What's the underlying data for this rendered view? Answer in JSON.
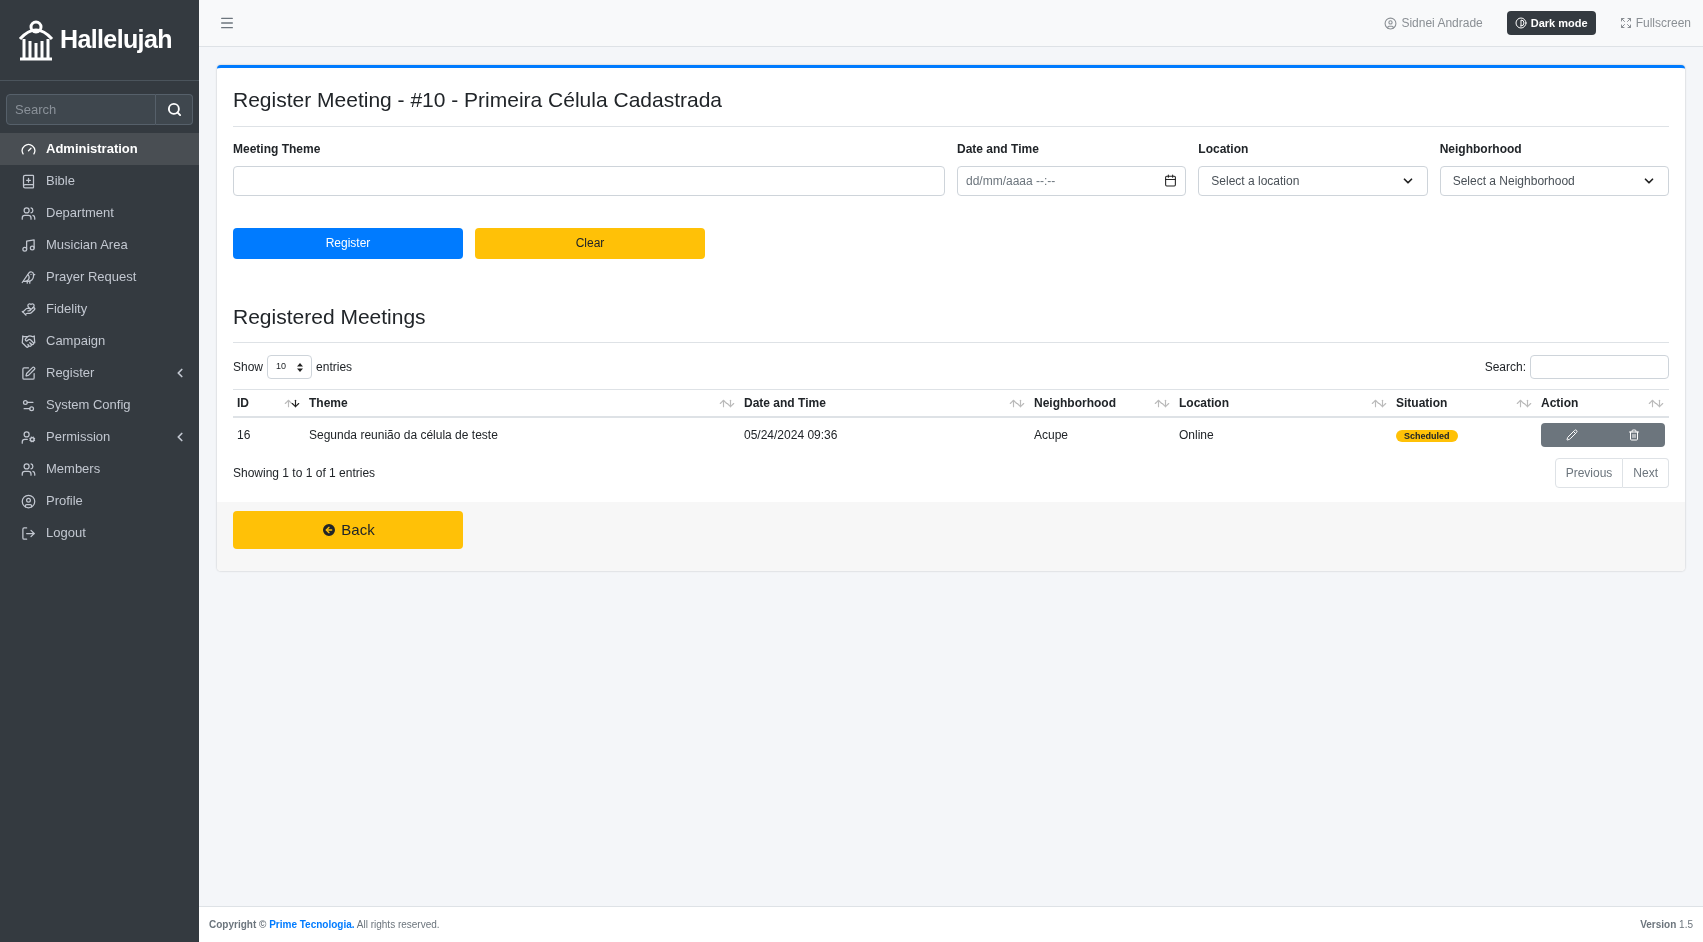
{
  "sidebar": {
    "logo": "Hallelujah",
    "search": {
      "placeholder": "Search"
    },
    "items": [
      {
        "label": "Administration",
        "selected": true,
        "expandable": false
      },
      {
        "label": "Bible",
        "selected": false,
        "expandable": false
      },
      {
        "label": "Department",
        "selected": false,
        "expandable": false
      },
      {
        "label": "Musician Area",
        "selected": false,
        "expandable": false
      },
      {
        "label": "Prayer Request",
        "selected": false,
        "expandable": false
      },
      {
        "label": "Fidelity",
        "selected": false,
        "expandable": false
      },
      {
        "label": "Campaign",
        "selected": false,
        "expandable": false
      },
      {
        "label": "Register",
        "selected": false,
        "expandable": true
      },
      {
        "label": "System Config",
        "selected": false,
        "expandable": false
      },
      {
        "label": "Permission",
        "selected": false,
        "expandable": true
      },
      {
        "label": "Members",
        "selected": false,
        "expandable": false
      },
      {
        "label": "Profile",
        "selected": false,
        "expandable": false
      },
      {
        "label": "Logout",
        "selected": false,
        "expandable": false
      }
    ]
  },
  "topbar": {
    "user": "Sidnei Andrade",
    "dark_mode": "Dark mode",
    "fullscreen": "Fullscreen"
  },
  "form": {
    "title": "Register Meeting - #10 - Primeira Célula Cadastrada",
    "fields": [
      {
        "kind": "text",
        "label": "Meeting Theme"
      },
      {
        "kind": "datetime",
        "label": "Date and Time",
        "placeholder": "dd/mm/aaaa --:--"
      },
      {
        "kind": "select",
        "label": "Location",
        "value": "Select a location"
      },
      {
        "kind": "select",
        "label": "Neighborhood",
        "value": "Select a Neighborhood"
      }
    ],
    "buttons": [
      {
        "kind": "primary",
        "label": "Register"
      },
      {
        "kind": "warning",
        "label": "Clear"
      }
    ]
  },
  "meetings": {
    "title": "Registered Meetings",
    "show": "Show",
    "page_size": "10",
    "entries": "entries",
    "search_label": "Search:",
    "columns": [
      {
        "label": "ID",
        "sorted": true
      },
      {
        "label": "Theme",
        "sorted": false
      },
      {
        "label": "Date and Time",
        "sorted": false
      },
      {
        "label": "Neighborhood",
        "sorted": false
      },
      {
        "label": "Location",
        "sorted": false
      },
      {
        "label": "Situation",
        "sorted": false
      },
      {
        "label": "Action",
        "sorted": false
      }
    ],
    "rows": [
      {
        "id": "16",
        "theme": "Segunda reunião da célula de teste",
        "date": "05/24/2024 09:36",
        "neighborhood": "Acupe",
        "location": "Online",
        "situation": "Scheduled"
      }
    ],
    "info": "Showing 1 to 1 of 1 entries",
    "pagination": [
      "Previous",
      "Next"
    ],
    "back": "Back"
  },
  "footer": {
    "copyright": "**Copyright ©**",
    "company": "Prime Tecnologia.",
    "rights": "All rights reserved.",
    "version": "**Version** 1.5"
  }
}
